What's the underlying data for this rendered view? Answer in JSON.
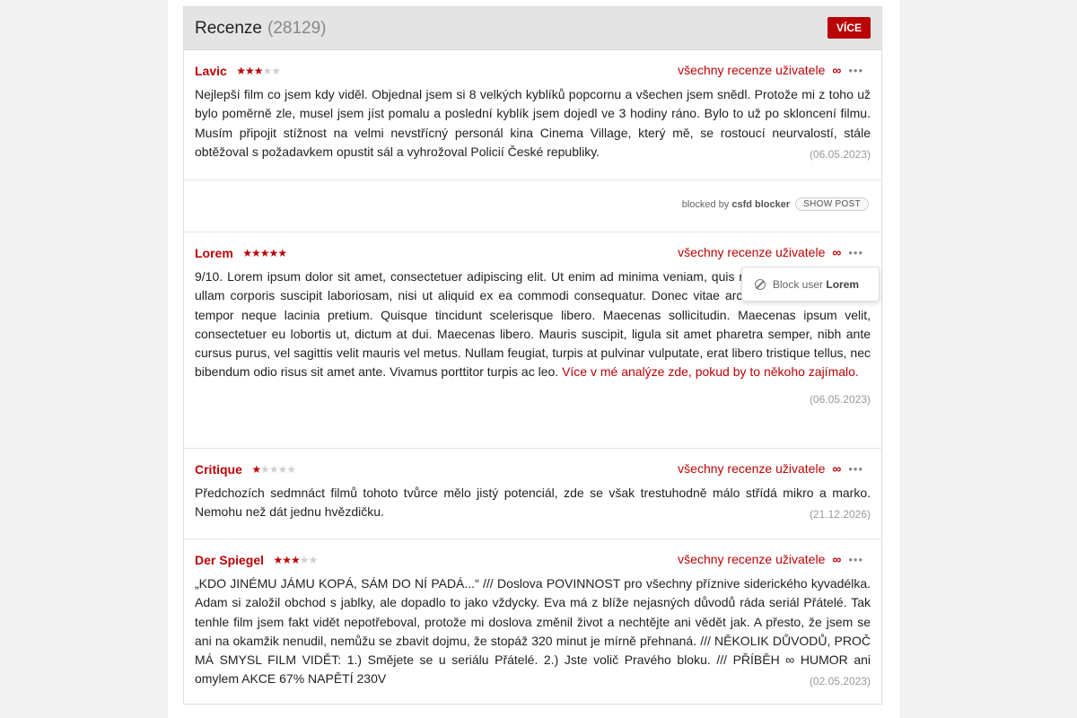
{
  "header": {
    "title": "Recenze",
    "count": "(28129)",
    "more_label": "VÍCE"
  },
  "user_links_label": "všechny recenze uživatele",
  "icons": {
    "link": "link-icon",
    "more": "dots-icon",
    "ban": "ban-icon"
  },
  "accent_color": "#ba0305",
  "reviews": [
    {
      "author": "Lavic",
      "rating": 3,
      "max_rating": 5,
      "text": "Nejlepší film co jsem kdy viděl. Objednal jsem si 8 velkých kyblíků popcornu a všechen jsem snědl. Protože mi z toho už bylo poměrně zle, musel jsem jíst pomalu a poslední kyblík jsem dojedl ve 3 hodiny ráno. Bylo to už po skloncení filmu. Musím připojit stížnost na velmi nevstřícný personál kina Cinema Village, který mě, se rostoucí neurvalostí, stále obtěžoval s požadavkem opustit sál a vyhrožoval Policií České republiky.",
      "date": "(06.05.2023)"
    },
    {
      "author": "Lorem",
      "rating": 5,
      "max_rating": 5,
      "text": "9/10. Lorem ipsum dolor sit amet, consectetuer adipiscing elit. Ut enim ad minima veniam, quis nostrum exercitationem ullam corporis suscipit laboriosam, nisi ut aliquid ex ea commodi consequatur. Donec vitae arcu. Praesent vitae arcu tempor neque lacinia pretium. Quisque tincidunt scelerisque libero. Maecenas sollicitudin. Maecenas ipsum velit, consectetuer eu lobortis ut, dictum at dui. Maecenas libero. Mauris suscipit, ligula sit amet pharetra semper, nibh ante cursus purus, vel sagittis velit mauris vel metus. Nullam feugiat, turpis at pulvinar vulputate, erat libero tristique tellus, nec bibendum odio risus sit amet ante. Vivamus porttitor turpis ac leo.",
      "link_text": "Více v mé analýze zde, pokud by to někoho zajímalo.",
      "date": "(06.05.2023)"
    },
    {
      "author": "Critique",
      "rating": 1,
      "max_rating": 5,
      "text": "Předchozích sedmnáct filmů tohoto tvůrce mělo jistý potenciál, zde se však trestuhodně málo střídá mikro a marko. Nemohu než dát jednu hvězdičku.",
      "date": "(21.12.2026)"
    },
    {
      "author": "Der Spiegel",
      "rating": 3,
      "max_rating": 5,
      "text": "„KDO JINÉMU JÁMU KOPÁ, SÁM DO NÍ PADÁ...“ /// Doslova POVINNOST pro všechny příznive siderického kyvadélka. Adam si založil obchod s jablky, ale dopadlo to jako vždycky. Eva má z blíže nejasných důvodů ráda seriál Přátelé. Tak tenhle film jsem fakt vidět nepotřeboval, protože mi doslova změnil život a nechtějte ani vědět jak. A přesto, že jsem se ani na okamžik nenudil, nemůžu se zbavit dojmu, že stopáž 320 minut je mírně přehnaná. /// NĚKOLIK DŮVODŮ, PROČ MÁ SMYSL FILM VIDĚT: 1.) Smějete se u seriálu Přátelé. 2.) Jste volič Pravého bloku. /// PŘÍBĚH ∞ HUMOR ani omylem AKCE 67% NAPĚTÍ 230V",
      "date": "(02.05.2023)"
    }
  ],
  "blocked": {
    "label_prefix": "blocked by",
    "blocker_name": "csfd blocker",
    "show_label": "SHOW POST"
  },
  "popup": {
    "label": "Block user",
    "username": "Lorem"
  }
}
